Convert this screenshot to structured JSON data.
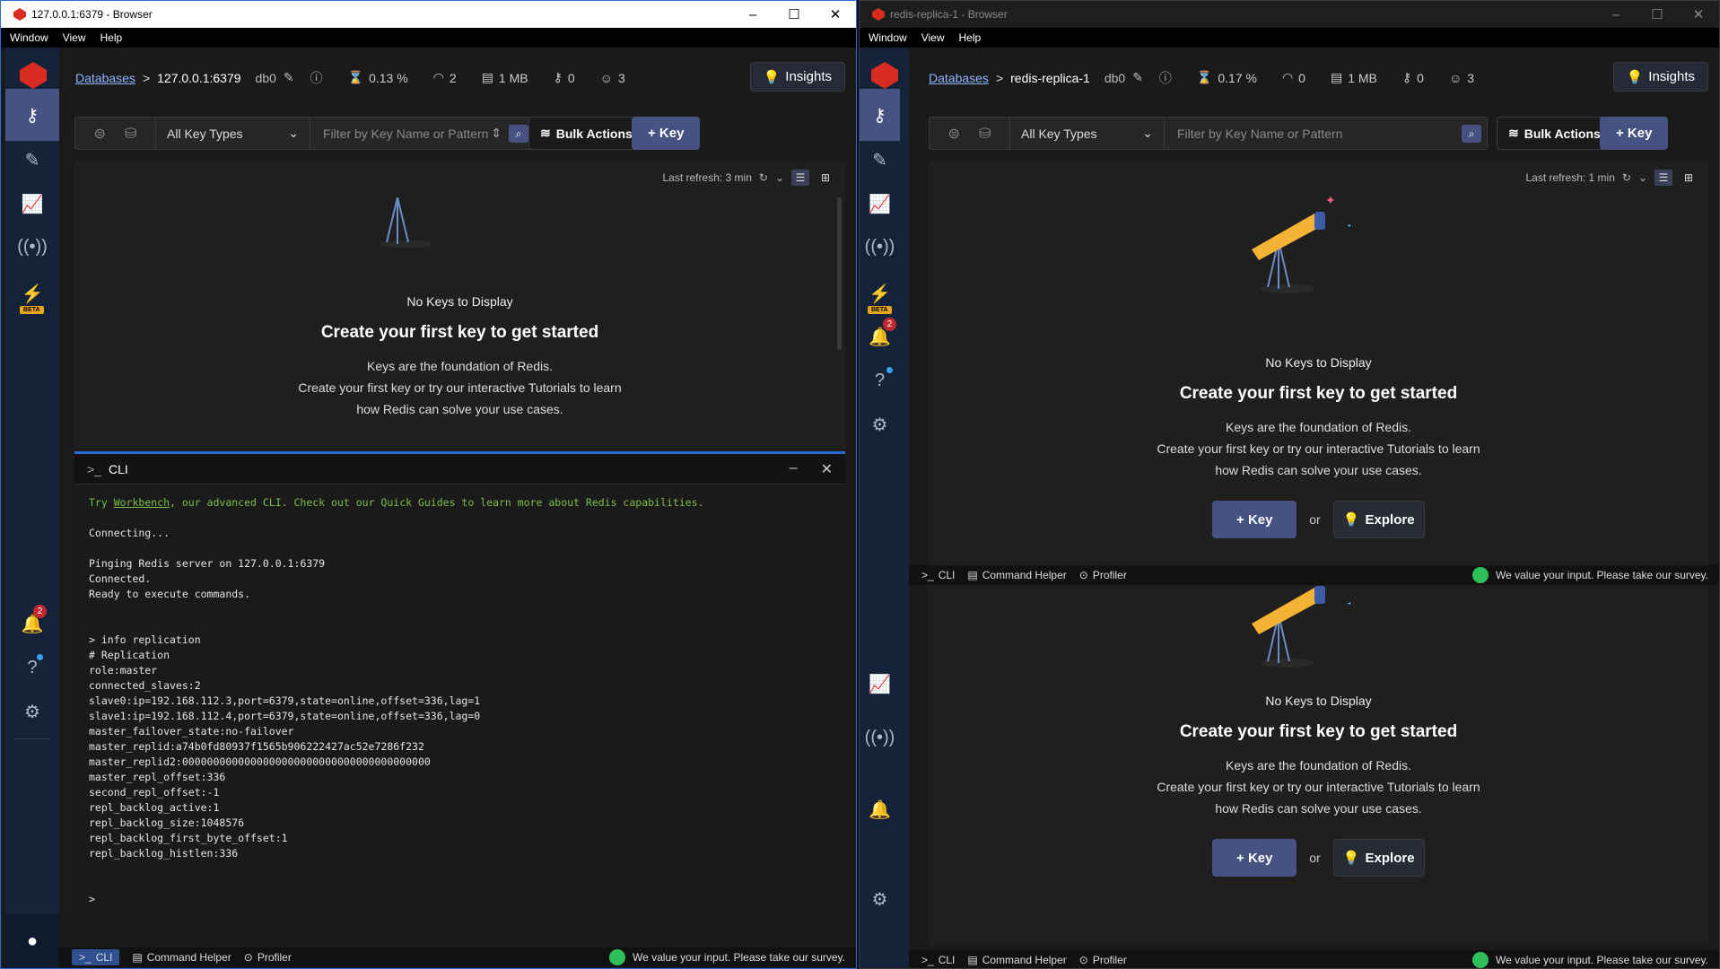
{
  "left": {
    "title": "127.0.0.1:6379 - Browser",
    "menu": [
      "Window",
      "View",
      "Help"
    ],
    "breadcrumb": {
      "link": "Databases",
      "db": "127.0.0.1:6379",
      "index": "db0"
    },
    "stats": {
      "cpu": "0.13 %",
      "ops": "2",
      "memory": "1 MB",
      "keys": "0",
      "clients": "3"
    },
    "insights": "Insights",
    "filter": {
      "key_type": "All Key Types",
      "placeholder": "Filter by Key Name or Pattern"
    },
    "bulk": "Bulk Actions",
    "add_key": "+ Key",
    "refresh": "Last refresh: 3 min",
    "empty": {
      "nokeys": "No Keys to Display",
      "create": "Create your first key to get started",
      "desc1": "Keys are the foundation of Redis.",
      "desc2": "Create your first key or try our interactive Tutorials to learn",
      "desc3": "how Redis can solve your use cases."
    },
    "cli": {
      "title": "CLI",
      "hint_pre": "Try ",
      "hint_link": "Workbench",
      "hint_post": ", our advanced CLI. Check out our Quick Guides to learn more about Redis capabilities.",
      "lines": [
        "",
        "Connecting...",
        "",
        "Pinging Redis server on 127.0.0.1:6379",
        "Connected.",
        "Ready to execute commands.",
        "",
        "",
        "> info replication",
        "# Replication",
        "role:master",
        "connected_slaves:2",
        "slave0:ip=192.168.112.3,port=6379,state=online,offset=336,lag=1",
        "slave1:ip=192.168.112.4,port=6379,state=online,offset=336,lag=0",
        "master_failover_state:no-failover",
        "master_replid:a74b0fd80937f1565b906222427ac52e7286f232",
        "master_replid2:0000000000000000000000000000000000000000",
        "master_repl_offset:336",
        "second_repl_offset:-1",
        "repl_backlog_active:1",
        "repl_backlog_size:1048576",
        "repl_backlog_first_byte_offset:1",
        "repl_backlog_histlen:336",
        "",
        "",
        ">"
      ]
    },
    "footer": {
      "cli": "CLI",
      "helper": "Command Helper",
      "profiler": "Profiler",
      "survey": "We value your input. Please take our survey."
    },
    "notif_count": "2",
    "beta": "BETA"
  },
  "right": {
    "title": "redis-replica-1 - Browser",
    "menu": [
      "Window",
      "View",
      "Help"
    ],
    "breadcrumb": {
      "link": "Databases",
      "db": "redis-replica-1",
      "index": "db0"
    },
    "stats": {
      "cpu": "0.17 %",
      "ops": "0",
      "memory": "1 MB",
      "keys": "0",
      "clients": "3"
    },
    "insights": "Insights",
    "filter": {
      "key_type": "All Key Types",
      "placeholder": "Filter by Key Name or Pattern"
    },
    "bulk": "Bulk Actions",
    "add_key": "+ Key",
    "refresh": "Last refresh: 1 min",
    "empty": {
      "nokeys": "No Keys to Display",
      "create": "Create your first key to get started",
      "desc1": "Keys are the foundation of Redis.",
      "desc2": "Create your first key or try our interactive Tutorials to learn",
      "desc3": "how Redis can solve your use cases.",
      "key_btn": "+ Key",
      "or": "or",
      "explore": "Explore"
    },
    "footer": {
      "cli": "CLI",
      "helper": "Command Helper",
      "profiler": "Profiler",
      "survey": "We value your input. Please take our survey."
    },
    "notif_count": "2",
    "beta": "BETA"
  }
}
